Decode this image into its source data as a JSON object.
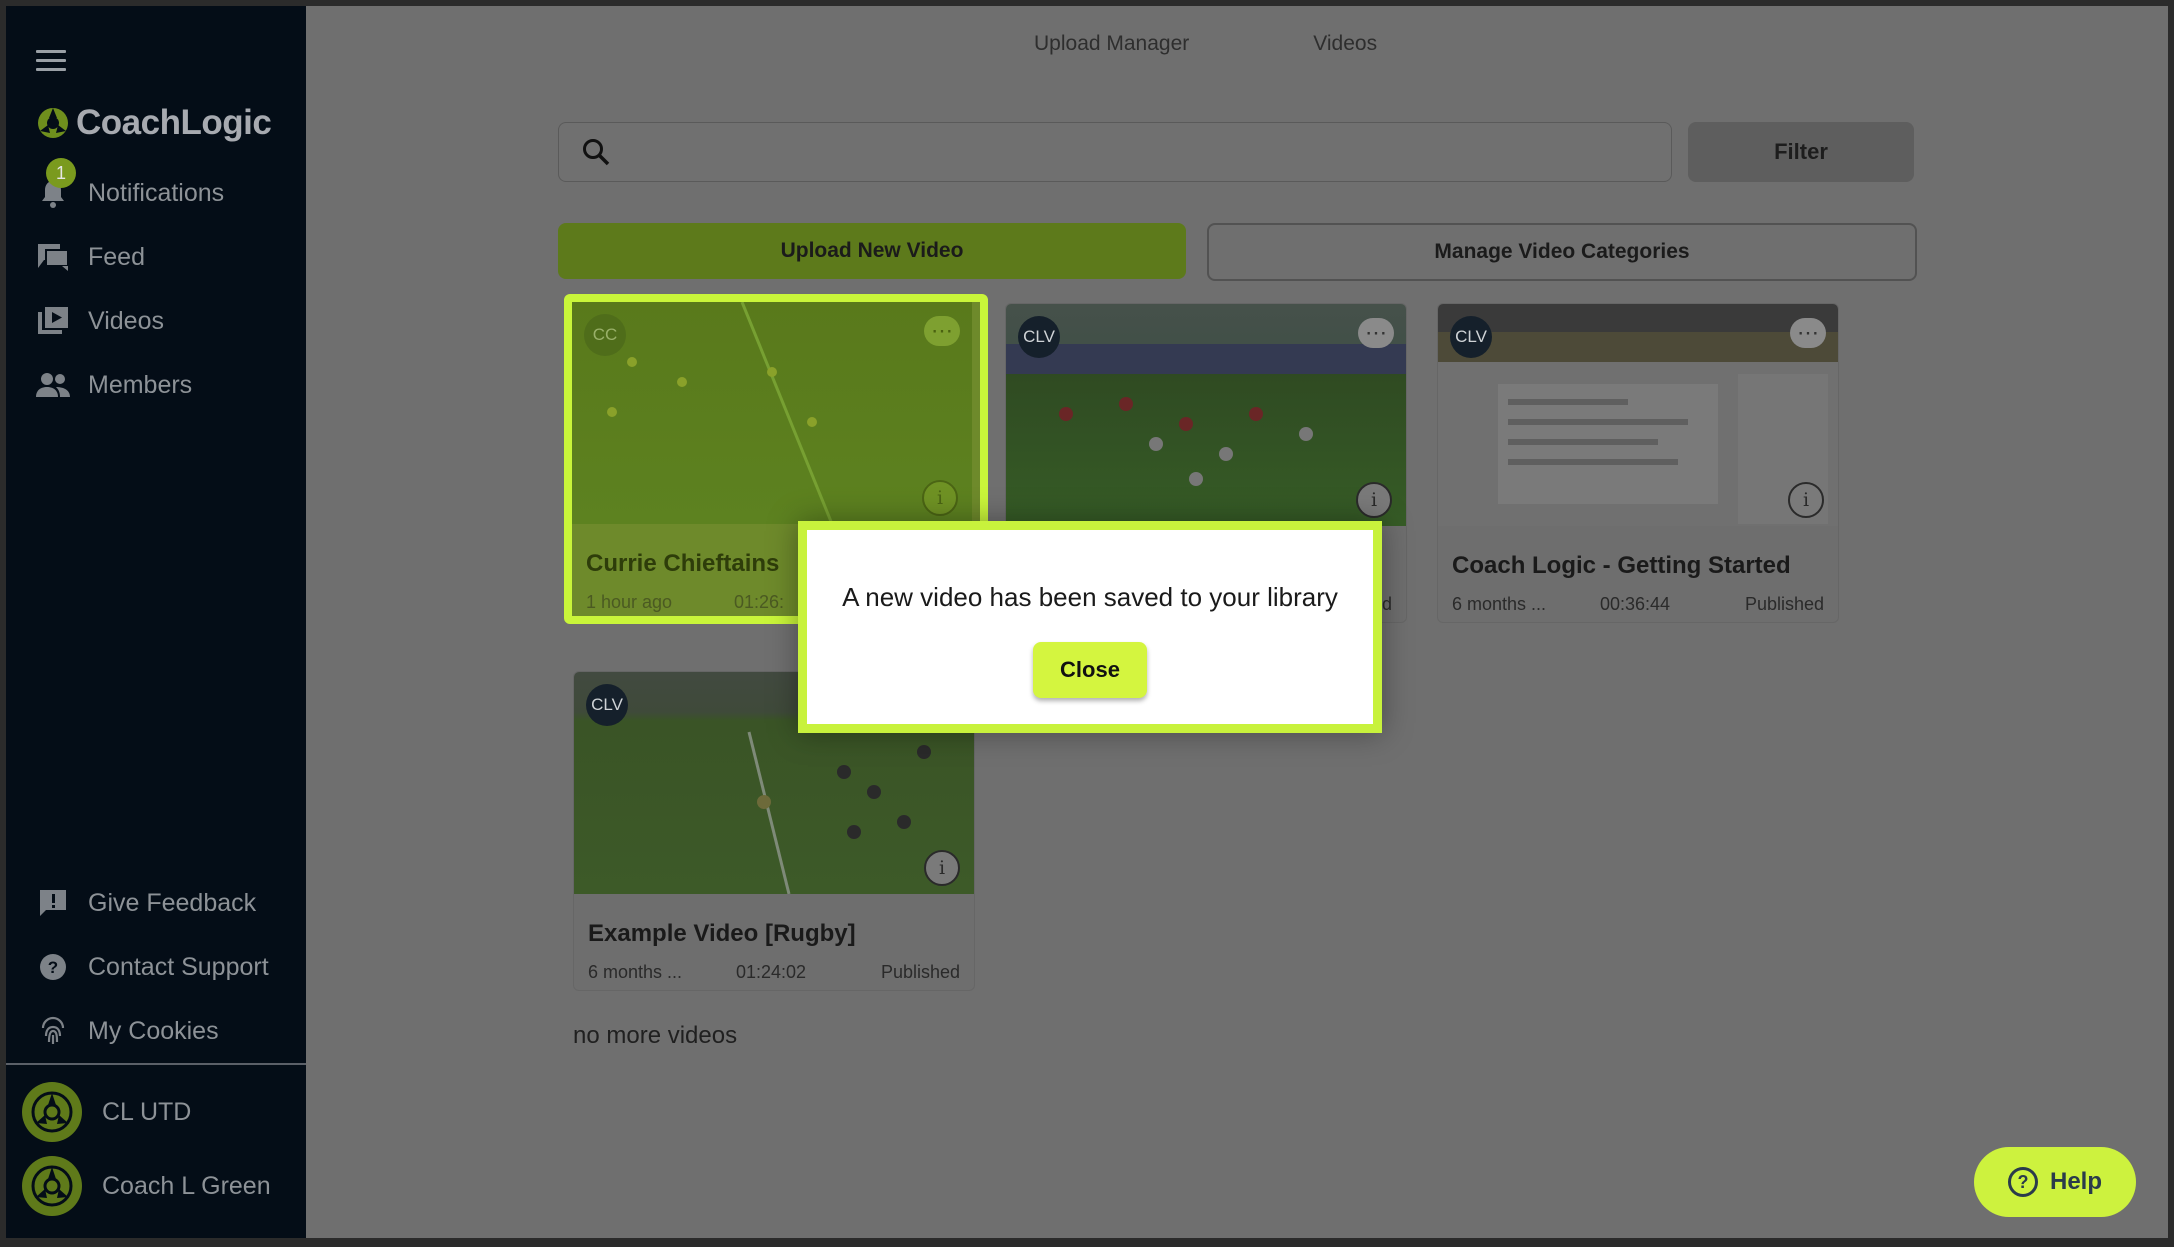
{
  "app": {
    "name": "CoachLogic"
  },
  "top_tabs": [
    "Upload Manager",
    "Videos"
  ],
  "sidebar": {
    "notification_count": "1",
    "items": [
      {
        "label": "Notifications",
        "icon": "bell-icon"
      },
      {
        "label": "Feed",
        "icon": "chat-icon"
      },
      {
        "label": "Videos",
        "icon": "video-library-icon"
      },
      {
        "label": "Members",
        "icon": "people-icon"
      }
    ],
    "bottom_items": [
      {
        "label": "Give Feedback",
        "icon": "feedback-icon"
      },
      {
        "label": "Contact Support",
        "icon": "help-circle-icon"
      },
      {
        "label": "My Cookies",
        "icon": "fingerprint-icon"
      }
    ],
    "profiles": [
      {
        "name": "CL UTD"
      },
      {
        "name": "Coach L Green"
      }
    ]
  },
  "search": {
    "placeholder": ""
  },
  "buttons": {
    "filter": "Filter",
    "upload": "Upload New Video",
    "manage": "Manage Video Categories"
  },
  "videos": [
    {
      "initials": "CC",
      "title": "Currie Chieftains",
      "time": "1 hour ago",
      "duration": "01:26:",
      "status": ""
    },
    {
      "initials": "CLV",
      "title": "",
      "time": "",
      "duration": "",
      "status": "ed"
    },
    {
      "initials": "CLV",
      "title": "Coach Logic - Getting Started",
      "time": "6 months ...",
      "duration": "00:36:44",
      "status": "Published"
    },
    {
      "initials": "CLV",
      "title": "Example Video [Rugby]",
      "time": "6 months ...",
      "duration": "01:24:02",
      "status": "Published"
    }
  ],
  "no_more": "no more videos",
  "modal": {
    "message": "A new video has been saved to your library",
    "close": "Close"
  },
  "help": {
    "label": "Help"
  },
  "colors": {
    "accent": "#c8f23c",
    "sidebar": "#040d17",
    "overlay": "#6f6f6f"
  }
}
